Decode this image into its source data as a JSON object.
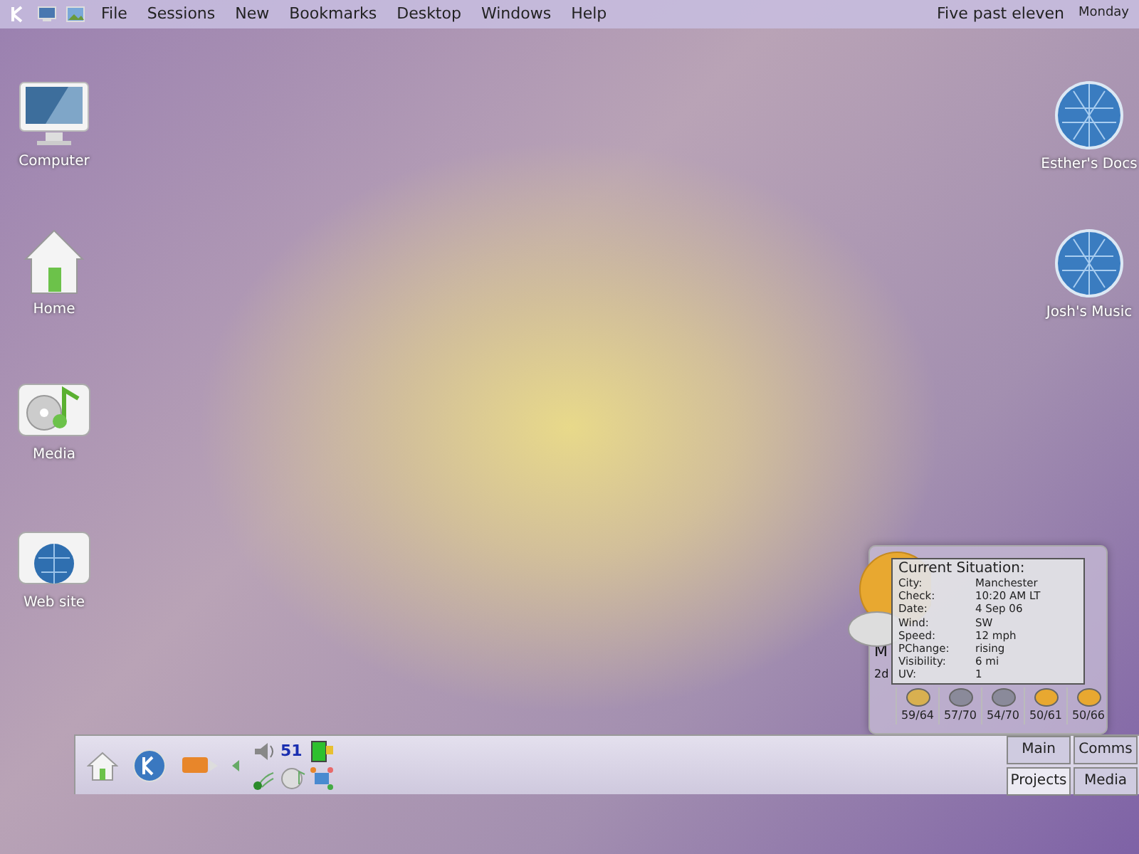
{
  "menu_bar": {
    "menus": [
      "File",
      "Sessions",
      "New",
      "Bookmarks",
      "Desktop",
      "Windows",
      "Help"
    ],
    "clock": "Five past eleven",
    "day": "Monday"
  },
  "desktop_icons_left": [
    {
      "label": "Computer",
      "kind": "computer"
    },
    {
      "label": "Home",
      "kind": "home"
    },
    {
      "label": "Media",
      "kind": "media"
    },
    {
      "label": "Web site",
      "kind": "website"
    }
  ],
  "desktop_icons_right": [
    {
      "label": "Esther's Docs",
      "kind": "globe"
    },
    {
      "label": "Josh's Music",
      "kind": "globe"
    }
  ],
  "weather_widget": {
    "partial_1": "M",
    "partial_2": "2d",
    "forecast": [
      {
        "temps": "59/64",
        "kind": "cloudy"
      },
      {
        "temps": "57/70",
        "kind": "rain"
      },
      {
        "temps": "54/70",
        "kind": "rain"
      },
      {
        "temps": "50/61",
        "kind": "sunny"
      },
      {
        "temps": "50/66",
        "kind": "sunny"
      }
    ],
    "tooltip": {
      "title": "Current Situation:",
      "rows": [
        {
          "label": "City:",
          "value": "Manchester"
        },
        {
          "label": "Check:",
          "value": "10:20 AM LT"
        },
        {
          "label": "Date:",
          "value": "4 Sep 06"
        },
        {
          "label": "Wind:",
          "value": "SW"
        },
        {
          "label": "Speed:",
          "value": "12 mph"
        },
        {
          "label": "PChange:",
          "value": "rising"
        },
        {
          "label": "Visibility:",
          "value": "6 mi"
        },
        {
          "label": "UV:",
          "value": "1"
        }
      ]
    }
  },
  "panel": {
    "tray_number": "51",
    "pager": [
      {
        "label": "Main",
        "selected": false
      },
      {
        "label": "Comms",
        "selected": false
      },
      {
        "label": "Projects",
        "selected": true
      },
      {
        "label": "Media",
        "selected": false
      }
    ]
  }
}
